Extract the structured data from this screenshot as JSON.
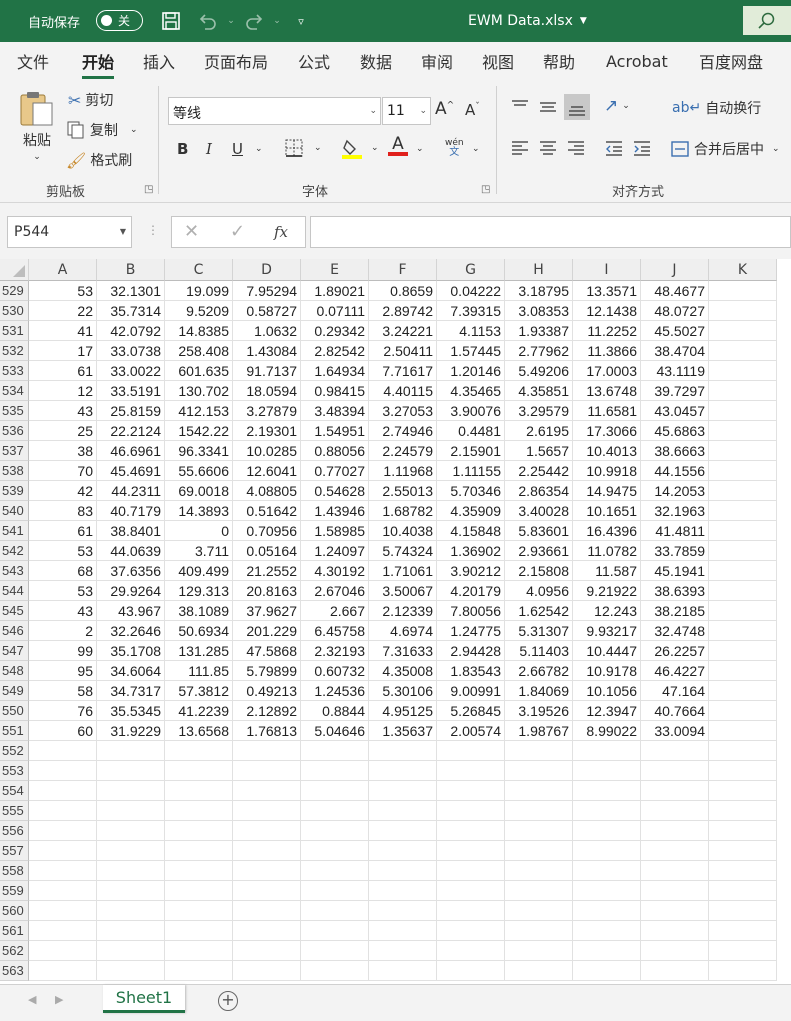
{
  "titlebar": {
    "autosave_label": "自动保存",
    "autosave_state": "关",
    "filename": "EWM Data.xlsx"
  },
  "tabs": [
    "文件",
    "开始",
    "插入",
    "页面布局",
    "公式",
    "数据",
    "审阅",
    "视图",
    "帮助",
    "Acrobat",
    "百度网盘"
  ],
  "active_tab": "开始",
  "ribbon": {
    "paste": "粘贴",
    "cut": "剪切",
    "copy": "复制",
    "format_painter": "格式刷",
    "clipboard_group": "剪贴板",
    "font_name": "等线",
    "font_size": "11",
    "bold": "B",
    "italic": "I",
    "underline": "U",
    "font_color_glyph": "A",
    "phonetic": "wén",
    "phonetic_sub": "文",
    "font_group": "字体",
    "wrap_text": "自动换行",
    "merge_center": "合并后居中",
    "alignment_group": "对齐方式"
  },
  "formula_bar": {
    "name_box": "P544",
    "fx": "fx",
    "formula": ""
  },
  "columns": [
    "A",
    "B",
    "C",
    "D",
    "E",
    "F",
    "G",
    "H",
    "I",
    "J",
    "K"
  ],
  "rows": [
    {
      "num": "529",
      "cells": [
        "53",
        "32.1301",
        "19.099",
        "7.95294",
        "1.89021",
        "0.8659",
        "0.04222",
        "3.18795",
        "13.3571",
        "48.4677"
      ]
    },
    {
      "num": "530",
      "cells": [
        "22",
        "35.7314",
        "9.5209",
        "0.58727",
        "0.07111",
        "2.89742",
        "7.39315",
        "3.08353",
        "12.1438",
        "48.0727"
      ]
    },
    {
      "num": "531",
      "cells": [
        "41",
        "42.0792",
        "14.8385",
        "1.0632",
        "0.29342",
        "3.24221",
        "4.1153",
        "1.93387",
        "11.2252",
        "45.5027"
      ]
    },
    {
      "num": "532",
      "cells": [
        "17",
        "33.0738",
        "258.408",
        "1.43084",
        "2.82542",
        "2.50411",
        "1.57445",
        "2.77962",
        "11.3866",
        "38.4704"
      ]
    },
    {
      "num": "533",
      "cells": [
        "61",
        "33.0022",
        "601.635",
        "91.7137",
        "1.64934",
        "7.71617",
        "1.20146",
        "5.49206",
        "17.0003",
        "43.1119"
      ]
    },
    {
      "num": "534",
      "cells": [
        "12",
        "33.5191",
        "130.702",
        "18.0594",
        "0.98415",
        "4.40115",
        "4.35465",
        "4.35851",
        "13.6748",
        "39.7297"
      ]
    },
    {
      "num": "535",
      "cells": [
        "43",
        "25.8159",
        "412.153",
        "3.27879",
        "3.48394",
        "3.27053",
        "3.90076",
        "3.29579",
        "11.6581",
        "43.0457"
      ]
    },
    {
      "num": "536",
      "cells": [
        "25",
        "22.2124",
        "1542.22",
        "2.19301",
        "1.54951",
        "2.74946",
        "0.4481",
        "2.6195",
        "17.3066",
        "45.6863"
      ]
    },
    {
      "num": "537",
      "cells": [
        "38",
        "46.6961",
        "96.3341",
        "10.0285",
        "0.88056",
        "2.24579",
        "2.15901",
        "1.5657",
        "10.4013",
        "38.6663"
      ]
    },
    {
      "num": "538",
      "cells": [
        "70",
        "45.4691",
        "55.6606",
        "12.6041",
        "0.77027",
        "1.11968",
        "1.11155",
        "2.25442",
        "10.9918",
        "44.1556"
      ]
    },
    {
      "num": "539",
      "cells": [
        "42",
        "44.2311",
        "69.0018",
        "4.08805",
        "0.54628",
        "2.55013",
        "5.70346",
        "2.86354",
        "14.9475",
        "14.2053"
      ]
    },
    {
      "num": "540",
      "cells": [
        "83",
        "40.7179",
        "14.3893",
        "0.51642",
        "1.43946",
        "1.68782",
        "4.35909",
        "3.40028",
        "10.1651",
        "32.1963"
      ]
    },
    {
      "num": "541",
      "cells": [
        "61",
        "38.8401",
        "0",
        "0.70956",
        "1.58985",
        "10.4038",
        "4.15848",
        "5.83601",
        "16.4396",
        "41.4811"
      ]
    },
    {
      "num": "542",
      "cells": [
        "53",
        "44.0639",
        "3.711",
        "0.05164",
        "1.24097",
        "5.74324",
        "1.36902",
        "2.93661",
        "11.0782",
        "33.7859"
      ]
    },
    {
      "num": "543",
      "cells": [
        "68",
        "37.6356",
        "409.499",
        "21.2552",
        "4.30192",
        "1.71061",
        "3.90212",
        "2.15808",
        "11.587",
        "45.1941"
      ]
    },
    {
      "num": "544",
      "cells": [
        "53",
        "29.9264",
        "129.313",
        "20.8163",
        "2.67046",
        "3.50067",
        "4.20179",
        "4.0956",
        "9.21922",
        "38.6393"
      ]
    },
    {
      "num": "545",
      "cells": [
        "43",
        "43.967",
        "38.1089",
        "37.9627",
        "2.667",
        "2.12339",
        "7.80056",
        "1.62542",
        "12.243",
        "38.2185"
      ]
    },
    {
      "num": "546",
      "cells": [
        "2",
        "32.2646",
        "50.6934",
        "201.229",
        "6.45758",
        "4.6974",
        "1.24775",
        "5.31307",
        "9.93217",
        "32.4748"
      ]
    },
    {
      "num": "547",
      "cells": [
        "99",
        "35.1708",
        "131.285",
        "47.5868",
        "2.32193",
        "7.31633",
        "2.94428",
        "5.11403",
        "10.4447",
        "26.2257"
      ]
    },
    {
      "num": "548",
      "cells": [
        "95",
        "34.6064",
        "111.85",
        "5.79899",
        "0.60732",
        "4.35008",
        "1.83543",
        "2.66782",
        "10.9178",
        "46.4227"
      ]
    },
    {
      "num": "549",
      "cells": [
        "58",
        "34.7317",
        "57.3812",
        "0.49213",
        "1.24536",
        "5.30106",
        "9.00991",
        "1.84069",
        "10.1056",
        "47.164"
      ]
    },
    {
      "num": "550",
      "cells": [
        "76",
        "35.5345",
        "41.2239",
        "2.12892",
        "0.8844",
        "4.95125",
        "5.26845",
        "3.19526",
        "12.3947",
        "40.7664"
      ]
    },
    {
      "num": "551",
      "cells": [
        "60",
        "31.9229",
        "13.6568",
        "1.76813",
        "5.04646",
        "1.35637",
        "2.00574",
        "1.98767",
        "8.99022",
        "33.0094"
      ]
    },
    {
      "num": "552",
      "cells": []
    },
    {
      "num": "553",
      "cells": []
    },
    {
      "num": "554",
      "cells": []
    },
    {
      "num": "555",
      "cells": []
    },
    {
      "num": "556",
      "cells": []
    },
    {
      "num": "557",
      "cells": []
    },
    {
      "num": "558",
      "cells": []
    },
    {
      "num": "559",
      "cells": []
    },
    {
      "num": "560",
      "cells": []
    },
    {
      "num": "561",
      "cells": []
    },
    {
      "num": "562",
      "cells": []
    },
    {
      "num": "563",
      "cells": []
    }
  ],
  "sheet_tab": "Sheet1",
  "colors": {
    "accent": "#217346",
    "ribbon_bg": "#f3f3f3"
  }
}
